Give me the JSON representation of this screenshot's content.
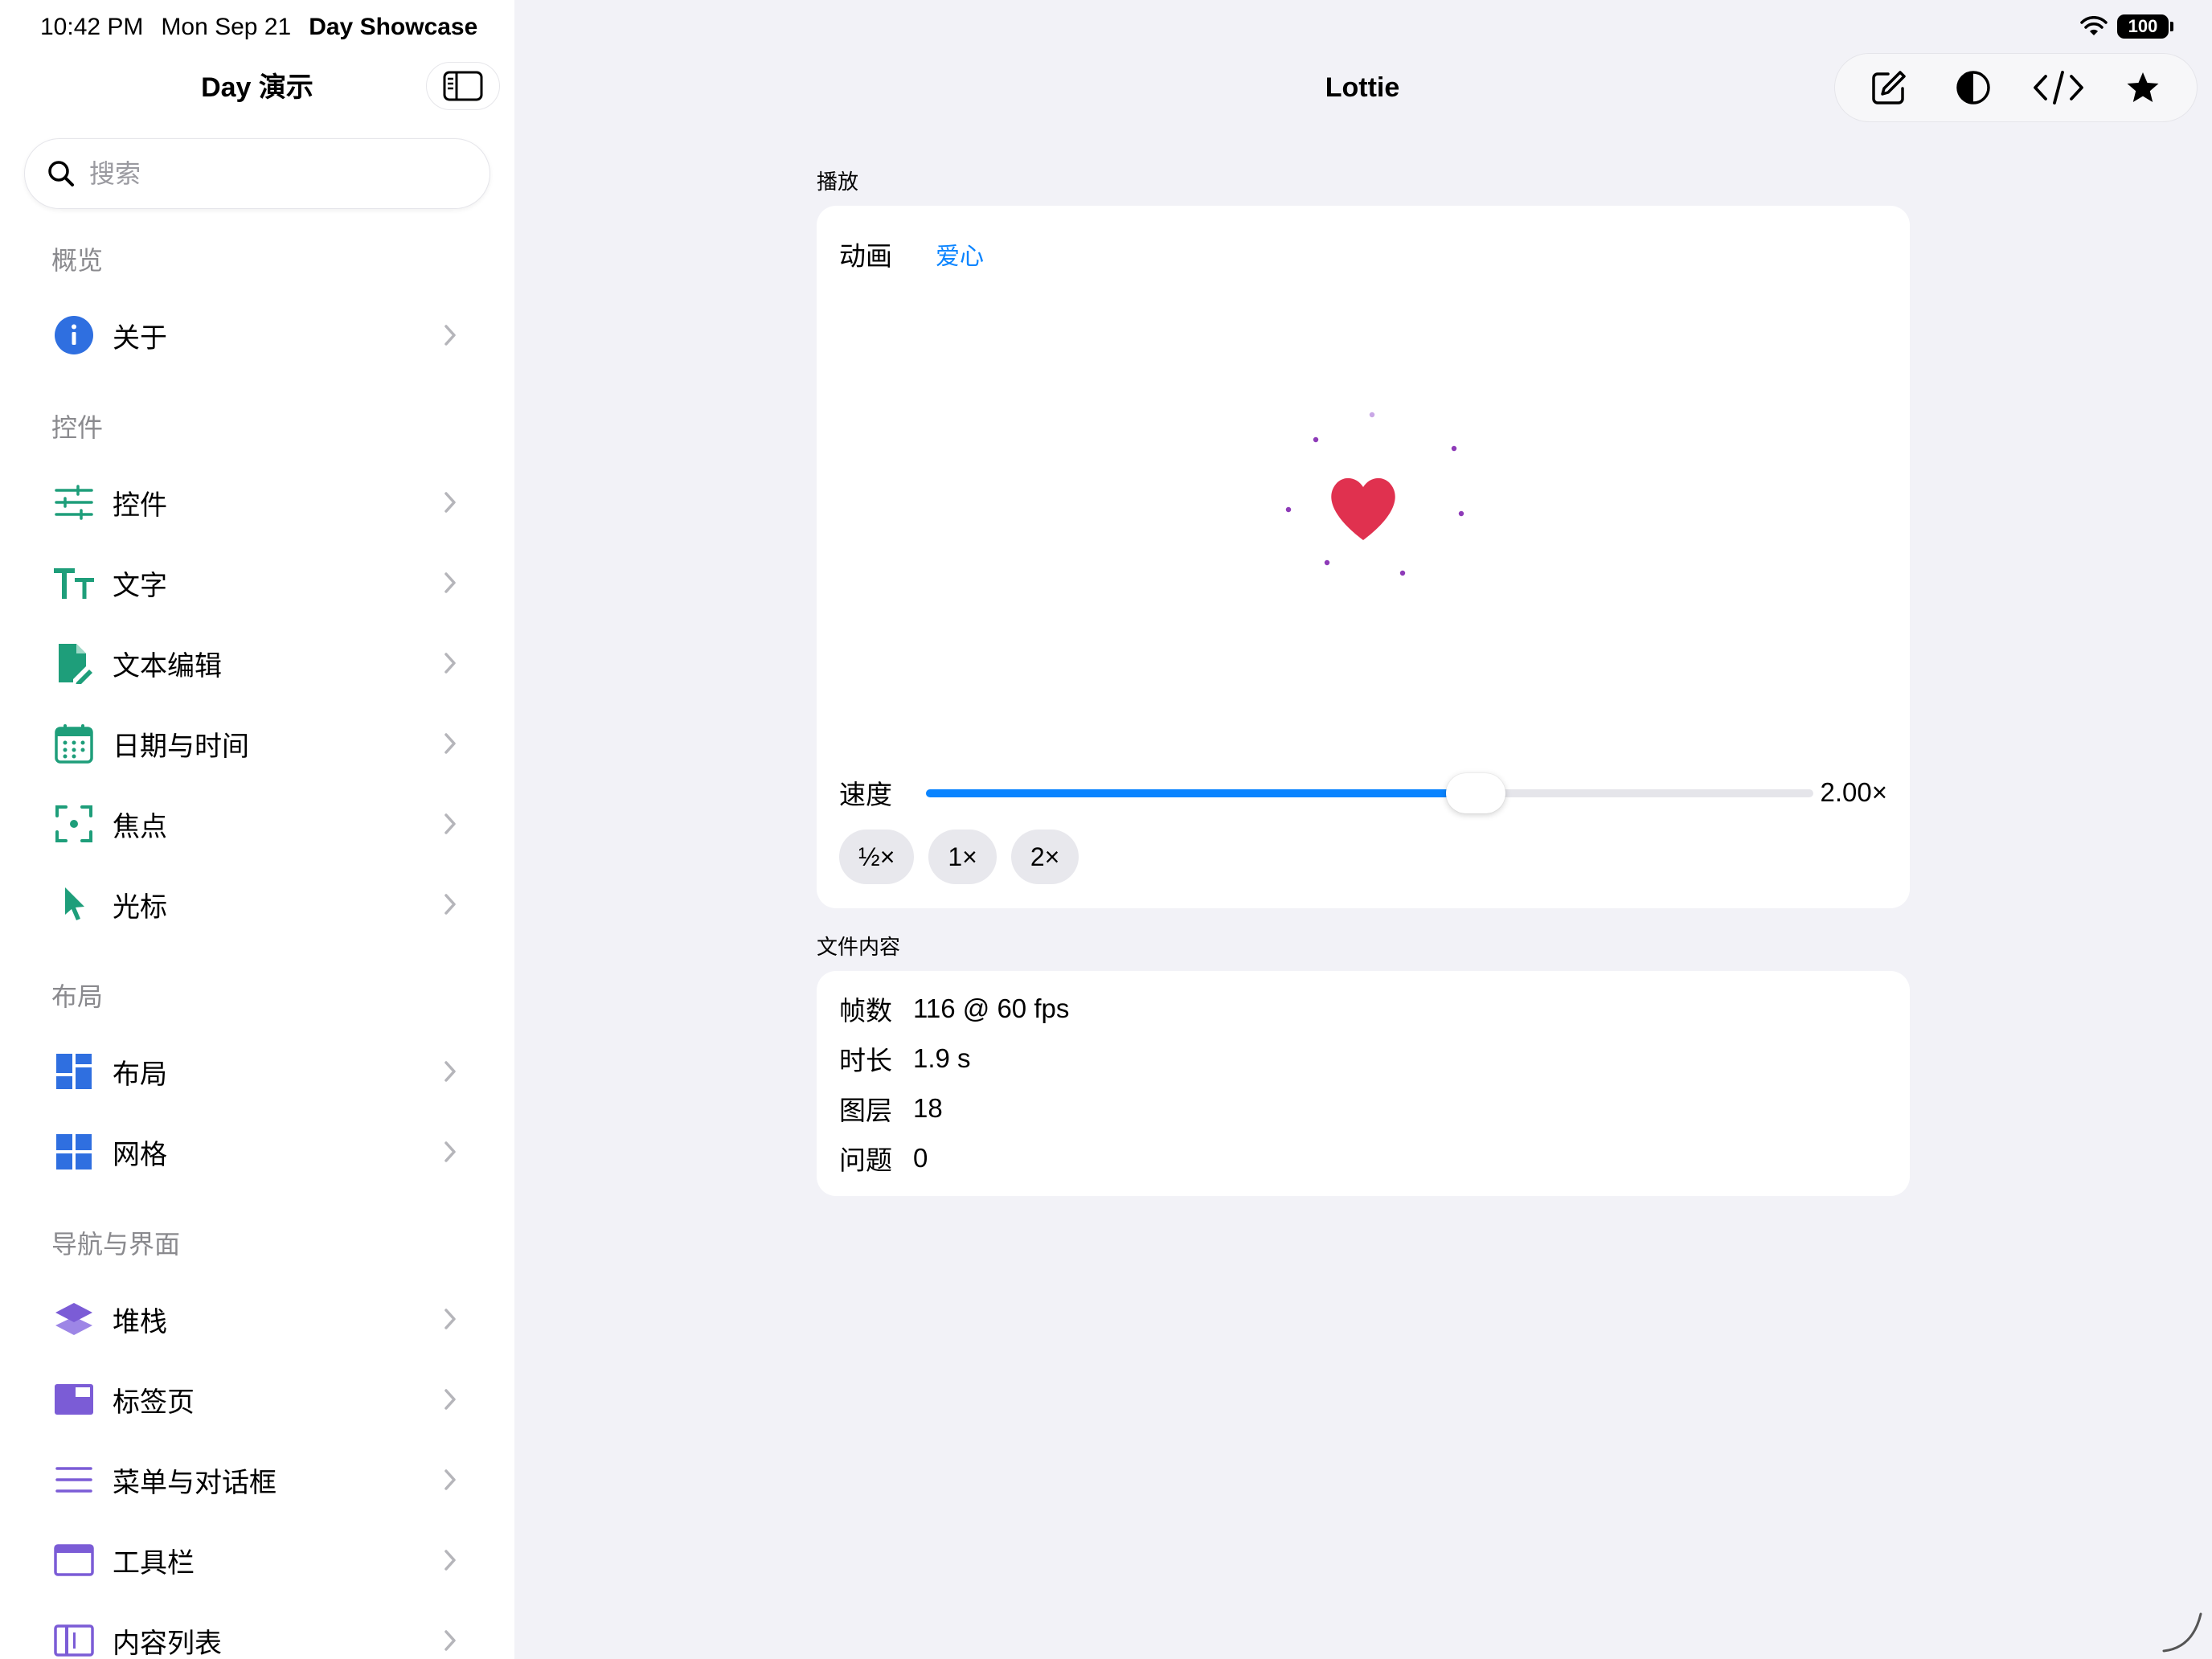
{
  "status": {
    "time": "10:42 PM",
    "date": "Mon Sep 21",
    "app_name": "Day Showcase",
    "battery": "100"
  },
  "sidebar": {
    "title": "Day 演示",
    "search_placeholder": "搜索",
    "sections": [
      {
        "header": "概览",
        "items": [
          {
            "label": "关于",
            "icon": "info-circle-icon",
            "color": "#2F6FE0"
          }
        ]
      },
      {
        "header": "控件",
        "items": [
          {
            "label": "控件",
            "icon": "sliders-icon",
            "color": "#1E9E7A"
          },
          {
            "label": "文字",
            "icon": "textformat-icon",
            "color": "#1E9E7A"
          },
          {
            "label": "文本编辑",
            "icon": "document-edit-icon",
            "color": "#1E9E7A"
          },
          {
            "label": "日期与时间",
            "icon": "calendar-icon",
            "color": "#1E9E7A"
          },
          {
            "label": "焦点",
            "icon": "focus-viewfinder-icon",
            "color": "#1E9E7A"
          },
          {
            "label": "光标",
            "icon": "pointer-arrow-icon",
            "color": "#1E9E7A"
          }
        ]
      },
      {
        "header": "布局",
        "items": [
          {
            "label": "布局",
            "icon": "layout-grid-icon",
            "color": "#2F6FE0"
          },
          {
            "label": "网格",
            "icon": "grid-icon",
            "color": "#2F6FE0"
          }
        ]
      },
      {
        "header": "导航与界面",
        "items": [
          {
            "label": "堆栈",
            "icon": "stack-layers-icon",
            "color": "#7B5CD6"
          },
          {
            "label": "标签页",
            "icon": "tabs-icon",
            "color": "#7B5CD6"
          },
          {
            "label": "菜单与对话框",
            "icon": "menu-lines-icon",
            "color": "#7B5CD6"
          },
          {
            "label": "工具栏",
            "icon": "window-toolbar-icon",
            "color": "#7B5CD6"
          },
          {
            "label": "内容列表",
            "icon": "sidebar-list-icon",
            "color": "#7B5CD6"
          }
        ]
      }
    ]
  },
  "main": {
    "title": "Lottie",
    "toolbar": [
      "compose-icon",
      "contrast-icon",
      "code-icon",
      "star-icon"
    ],
    "playback": {
      "group_label": "播放",
      "animation_key": "动画",
      "animation_value": "爱心",
      "speed_key": "速度",
      "speed_value": "2.00×",
      "speed_fraction": 0.62,
      "presets": [
        "½×",
        "1×",
        "2×"
      ]
    },
    "file": {
      "group_label": "文件内容",
      "rows": [
        {
          "key": "帧数",
          "value": "116 @ 60 fps"
        },
        {
          "key": "时长",
          "value": "1.9 s"
        },
        {
          "key": "图层",
          "value": "18"
        },
        {
          "key": "问题",
          "value": "0"
        }
      ]
    }
  },
  "colors": {
    "accent": "#0A84FF",
    "heart": "#E0314F",
    "particle": "#8E3BB8"
  }
}
